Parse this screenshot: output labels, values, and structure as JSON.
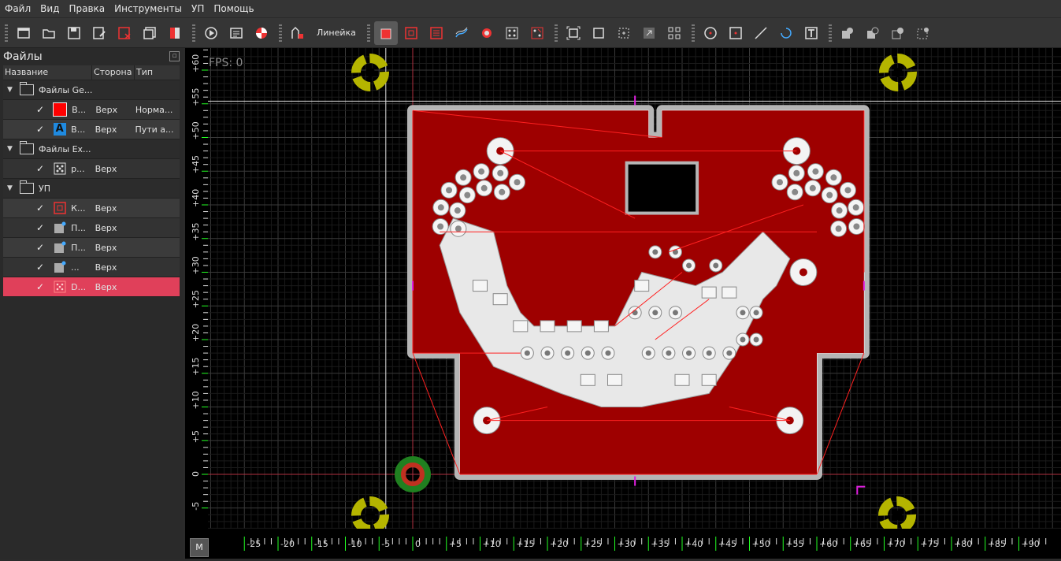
{
  "menu": [
    "Файл",
    "Вид",
    "Правка",
    "Инструменты",
    "УП",
    "Помощь"
  ],
  "toolbar": {
    "buttons_group1": [
      "new-file-icon",
      "open-folder-icon",
      "save-icon",
      "save-as-icon",
      "close-file-icon",
      "save-all-icon",
      "close-all-icon"
    ],
    "buttons_group2": [
      "play-icon",
      "settings-icon",
      "pie-icon"
    ],
    "ruler_label": "Линейка",
    "buttons_group3": [
      "profile-tool-icon",
      "pocket-tool-icon",
      "pocket-raster-icon",
      "thermal-icon",
      "drill-icon",
      "dots-icon",
      "text-icon"
    ],
    "buttons_group4": [
      "zoom-fit-icon",
      "zoom-frame-icon",
      "zoom-sel-icon",
      "zoom-in-icon",
      "grid-icon"
    ],
    "buttons_group5": [
      "circle-icon",
      "rect-icon",
      "line-icon",
      "arc-icon",
      "text-tool-icon"
    ],
    "buttons_group6": [
      "union-icon",
      "subtract-icon",
      "intersect-icon",
      "select-icon"
    ]
  },
  "panel": {
    "title": "Файлы",
    "columns": {
      "name": "Название",
      "side": "Сторона",
      "type": "Тип"
    }
  },
  "tree": [
    {
      "kind": "folder",
      "label": "Файлы Ge..."
    },
    {
      "kind": "leaf",
      "icon": "red-square-icon",
      "name": "В...",
      "side": "Верх",
      "type": "Норма..."
    },
    {
      "kind": "leaf",
      "icon": "letter-a-icon",
      "name": "В...",
      "side": "Верх",
      "type": "Пути а..."
    },
    {
      "kind": "folder",
      "label": "Файлы Ex..."
    },
    {
      "kind": "leaf",
      "icon": "dots-icon",
      "name": "p...",
      "side": "Верх",
      "type": ""
    },
    {
      "kind": "folder",
      "label": "УП"
    },
    {
      "kind": "leaf",
      "icon": "profile-icon",
      "name": "К...",
      "side": "Верх",
      "type": ""
    },
    {
      "kind": "leaf",
      "icon": "pocket-icon",
      "name": "П...",
      "side": "Верх",
      "type": ""
    },
    {
      "kind": "leaf",
      "icon": "pocket-icon",
      "name": "П...",
      "side": "Верх",
      "type": ""
    },
    {
      "kind": "leaf",
      "icon": "pocket-icon",
      "name": "...",
      "side": "Верх",
      "type": ""
    },
    {
      "kind": "leaf",
      "icon": "drill-icon",
      "name": "D...",
      "side": "Верх",
      "type": "",
      "selected": true
    }
  ],
  "canvas": {
    "fps": "FPS: 0",
    "x_ticks": [
      "-25",
      "-20",
      "-15",
      "-10",
      "-5",
      "0",
      "5",
      "10",
      "15",
      "20",
      "25",
      "30",
      "35",
      "40",
      "45",
      "50",
      "55",
      "60",
      "65",
      "70",
      "75",
      "80",
      "85",
      "90"
    ],
    "y_ticks": [
      "60",
      "55",
      "50",
      "45",
      "40",
      "35",
      "30",
      "25",
      "20",
      "15",
      "10",
      "5",
      "0",
      "-5"
    ],
    "mode_button": "M"
  },
  "colors": {
    "board": "#9e0000",
    "trace": "#ff2020",
    "copper": "#f0f0f0",
    "outline": "#b5b5b5",
    "marker": "#b5b500"
  }
}
